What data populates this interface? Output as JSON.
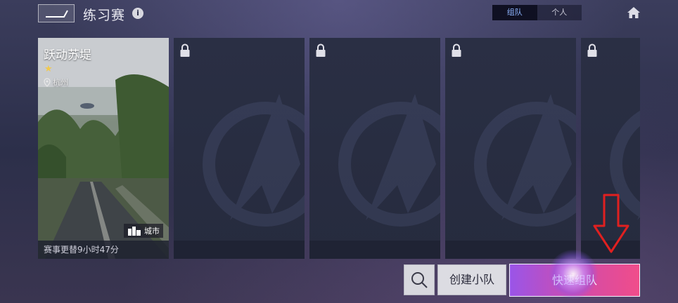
{
  "header": {
    "title": "练习赛",
    "info_icon": "i",
    "mode_tabs": [
      {
        "label": "组队",
        "active": true
      },
      {
        "label": "个人",
        "active": false
      }
    ]
  },
  "cards": {
    "featured": {
      "name": "跃动苏堤",
      "stars": "★",
      "location": "杭州",
      "tag": "城市",
      "rotation_text": "赛事更替9小时47分"
    },
    "locked_count": 4
  },
  "actions": {
    "create_team": "创建小队",
    "quick_match": "快速组队"
  },
  "colors": {
    "accent_blue": "#8fb6ff",
    "star": "#f2c94c",
    "quick_start": "#9a55e8",
    "quick_end": "#f04d8a",
    "annotation_red": "#e02020"
  }
}
